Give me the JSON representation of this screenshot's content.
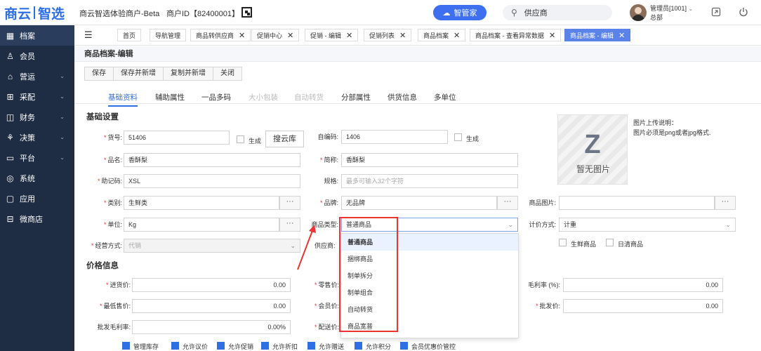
{
  "topbar": {
    "logo_a": "商云",
    "logo_b": "智选",
    "app_title": "商云智选体验商户-Beta",
    "merchant": "商户ID【82400001】",
    "ai_button": "智管家",
    "search_text": "供应商",
    "user_name": "管理员[1001]",
    "user_dept": "总部",
    "icons": [
      "qr-code-icon",
      "search-icon",
      "fullscreen-icon",
      "power-icon"
    ]
  },
  "sidebar": {
    "items": [
      {
        "icon": "grid-icon",
        "label": "档案",
        "chev": false
      },
      {
        "icon": "user-icon",
        "label": "会员",
        "chev": false
      },
      {
        "icon": "shop-icon",
        "label": "营运",
        "chev": true
      },
      {
        "icon": "cart-icon",
        "label": "采配",
        "chev": true
      },
      {
        "icon": "wallet-icon",
        "label": "财务",
        "chev": true
      },
      {
        "icon": "decision-icon",
        "label": "决策",
        "chev": true
      },
      {
        "icon": "monitor-icon",
        "label": "平台",
        "chev": true
      },
      {
        "icon": "system-icon",
        "label": "系统",
        "chev": false
      },
      {
        "icon": "app-icon",
        "label": "应用",
        "chev": false
      },
      {
        "icon": "store-icon",
        "label": "微商店",
        "chev": false
      }
    ]
  },
  "tabs": [
    {
      "label": "首页",
      "closable": false
    },
    {
      "label": "导航管理",
      "closable": false
    },
    {
      "label": "商品转供应商",
      "closable": true
    },
    {
      "label": "促销中心",
      "closable": true
    },
    {
      "label": "促销 - 编辑",
      "closable": true
    },
    {
      "label": "促销列表",
      "closable": true
    },
    {
      "label": "商品档案",
      "closable": true
    },
    {
      "label": "商品档案 - 查看异常数据",
      "closable": true
    },
    {
      "label": "商品档案 - 编辑",
      "closable": true,
      "active": true
    }
  ],
  "page": {
    "title": "商品档案-编辑"
  },
  "toolbar": {
    "save": "保存",
    "save_new": "保存并新增",
    "copy_new": "复制并新增",
    "close": "关闭"
  },
  "subtabs": [
    "基础资料",
    "辅助属性",
    "一品多码",
    "大小包装",
    "自动转货",
    "分部属性",
    "供货信息",
    "多单位"
  ],
  "sections": {
    "basic": "基础设置",
    "price": "价格信息"
  },
  "form": {
    "huohao": {
      "label": "货号:",
      "value": "51406"
    },
    "gen1": "生成",
    "yunku": "搜云库",
    "zibianma": {
      "label": "自编码:",
      "value": "1406"
    },
    "gen2": "生成",
    "pinming": {
      "label": "品名:",
      "value": "香酥梨"
    },
    "jiancheng": {
      "label": "简称:",
      "value": "香酥梨"
    },
    "zhujima": {
      "label": "助记码:",
      "value": "XSL"
    },
    "guige": {
      "label": "规格:",
      "placeholder": "最多可输入32个字符"
    },
    "leibie": {
      "label": "类别:",
      "value": "生鲜类"
    },
    "pinpai": {
      "label": "品牌:",
      "value": "无品牌"
    },
    "shangpintupian": {
      "label": "商品图片:"
    },
    "danwei": {
      "label": "单位:",
      "value": "Kg"
    },
    "leixing": {
      "label": "商品类型:",
      "value": "普通商品"
    },
    "jijia": {
      "label": "计价方式:",
      "value": "计重"
    },
    "jingying": {
      "label": "经营方式:",
      "value": "代销"
    },
    "gongying": {
      "label": "供应商:"
    },
    "fresh": "生鲜商品",
    "daily": "日清商品",
    "dots": "···"
  },
  "price": {
    "jinhuo": {
      "label": "进货价:",
      "value": "0.00"
    },
    "lingshou": {
      "label": "零售价:"
    },
    "maoli": {
      "label": "毛利率 (%):",
      "value": "0.00"
    },
    "zuidi": {
      "label": "最低售价:",
      "value": "0.00"
    },
    "huiyuan": {
      "label": "会员价:"
    },
    "pifa": {
      "label": "批发价:",
      "value": "0.00"
    },
    "pifamaoli": {
      "label": "批发毛利率:",
      "value": "0.00%"
    },
    "peisong": {
      "label": "配送价:"
    }
  },
  "image": {
    "placeholder": "暂无图片",
    "note1": "图片上传说明：",
    "note2": "图片必须是png或者jpg格式."
  },
  "dropdown": {
    "options": [
      "普通商品",
      "捆绑商品",
      "制单拆分",
      "制单组合",
      "自动转货",
      "商品宽普"
    ],
    "selected_index": 0
  },
  "bottom_checks": [
    "管理库存",
    "允许议价",
    "允许促销",
    "允许折扣",
    "允许赠送",
    "允许积分",
    "会员优惠价管控"
  ]
}
